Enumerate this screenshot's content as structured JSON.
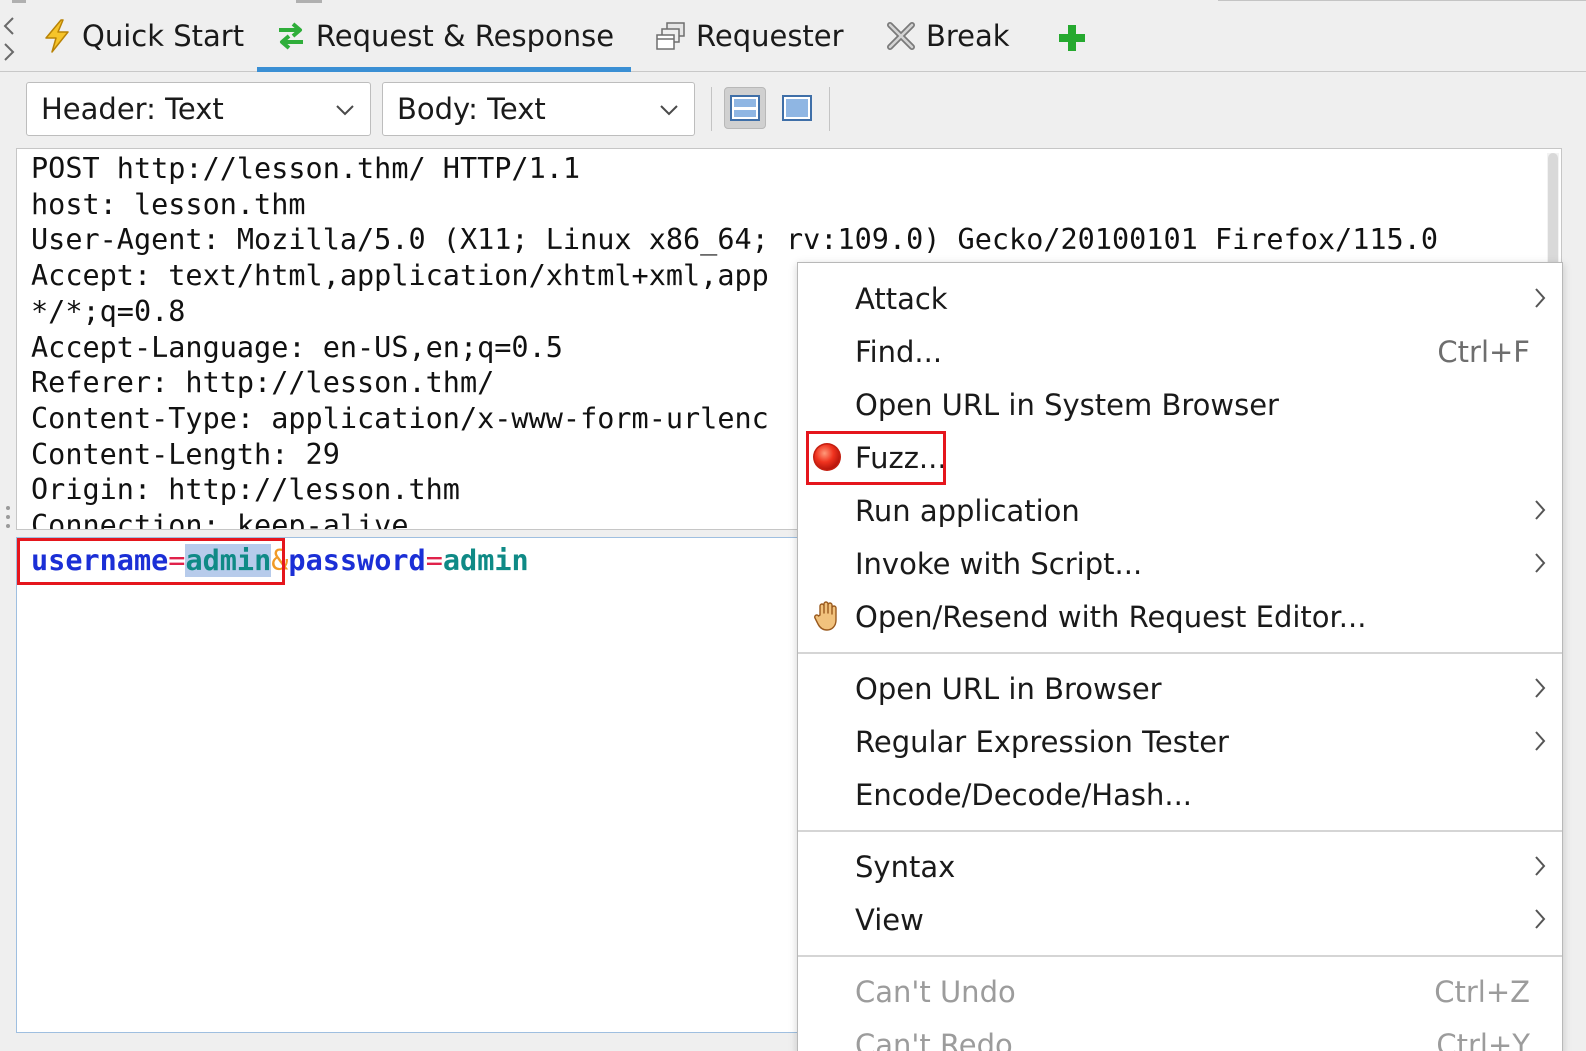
{
  "tabs": [
    {
      "label": "Quick Start",
      "icon": "lightning-icon"
    },
    {
      "label": "Request & Response",
      "icon": "exchange-arrows-icon",
      "active": true
    },
    {
      "label": "Requester",
      "icon": "requester-windows-icon"
    },
    {
      "label": "Break",
      "icon": "break-x-icon"
    }
  ],
  "add_tab_icon": "plus-icon",
  "toolbar": {
    "header_view": "Header: Text",
    "body_view": "Body: Text",
    "layout_buttons": [
      "split-vertical-icon",
      "single-pane-icon"
    ]
  },
  "request": {
    "header_lines": [
      "POST http://lesson.thm/ HTTP/1.1",
      "host: lesson.thm",
      "User-Agent: Mozilla/5.0 (X11; Linux x86_64; rv:109.0) Gecko/20100101 Firefox/115.0",
      "Accept: text/html,application/xhtml+xml,app",
      "*/*;q=0.8",
      "Accept-Language: en-US,en;q=0.5",
      "Referer: http://lesson.thm/",
      "Content-Type: application/x-www-form-urlenc",
      "Content-Length: 29",
      "Origin: http://lesson.thm",
      "Connection: keep-alive"
    ],
    "body": {
      "key1": "username",
      "eq1": "=",
      "val1": "admin",
      "amp": "&",
      "key2": "password",
      "eq2": "=",
      "val2": "admin"
    }
  },
  "context_menu": {
    "groups": [
      [
        {
          "label": "Attack",
          "submenu": true
        },
        {
          "label": "Find...",
          "shortcut": "Ctrl+F"
        },
        {
          "label": "Open URL in System Browser"
        },
        {
          "label": "Fuzz...",
          "icon": "fuzz-red-dot-icon",
          "highlighted": true
        },
        {
          "label": "Run application",
          "submenu": true
        },
        {
          "label": "Invoke with Script...",
          "submenu": true
        },
        {
          "label": "Open/Resend with Request Editor...",
          "icon": "hand-icon"
        }
      ],
      [
        {
          "label": "Open URL in Browser",
          "submenu": true
        },
        {
          "label": "Regular Expression Tester",
          "submenu": true
        },
        {
          "label": "Encode/Decode/Hash..."
        }
      ],
      [
        {
          "label": "Syntax",
          "submenu": true
        },
        {
          "label": "View",
          "submenu": true
        }
      ],
      [
        {
          "label": "Can't Undo",
          "shortcut": "Ctrl+Z",
          "disabled": true
        },
        {
          "label": "Can't Redo",
          "shortcut": "Ctrl+Y",
          "disabled": true
        }
      ]
    ]
  },
  "colors": {
    "active_tab_underline": "#3a8fd4",
    "highlight_box": "#e5161d",
    "param_key": "#1b2fd6",
    "param_value": "#0f8a86",
    "param_equals": "#e0224a",
    "param_ampersand": "#f19a27",
    "selection": "#b7cbeb"
  }
}
